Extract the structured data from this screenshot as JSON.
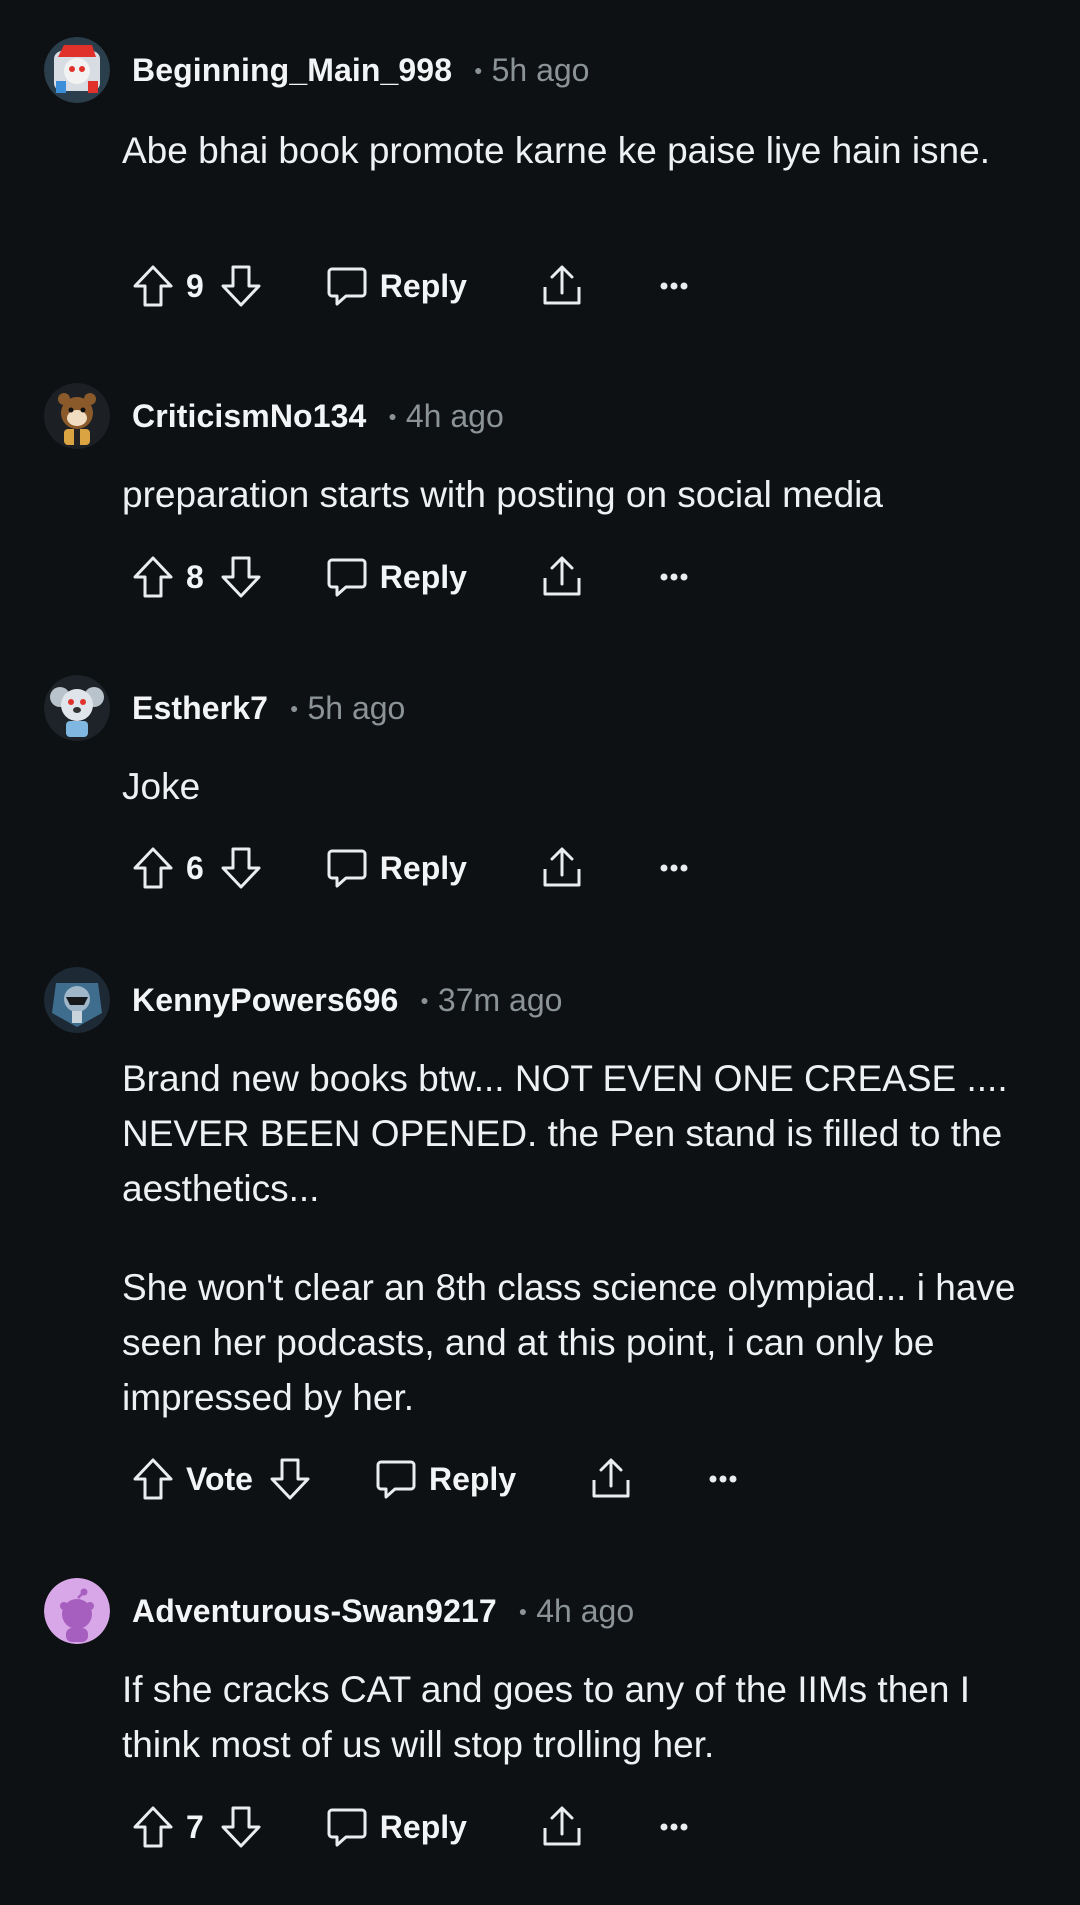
{
  "colors": {
    "background": "#0e1113",
    "text": "#eef1f2",
    "muted": "#8b9396"
  },
  "actions": {
    "reply_label": "Reply"
  },
  "comments": [
    {
      "username": "Beginning_Main_998",
      "time": "5h ago",
      "body": [
        "Abe bhai book promote karne ke paise liye hain isne."
      ],
      "votes": "9",
      "avatar": "snoo-avatar-red-hat"
    },
    {
      "username": "CriticismNo134",
      "time": "4h ago",
      "body": [
        "preparation starts with posting on social media"
      ],
      "votes": "8",
      "avatar": "snoo-avatar-bear"
    },
    {
      "username": "Estherk7",
      "time": "5h ago",
      "body": [
        "Joke"
      ],
      "votes": "6",
      "avatar": "snoo-avatar-koala"
    },
    {
      "username": "KennyPowers696",
      "time": "37m ago",
      "body": [
        "Brand new books btw... NOT EVEN ONE CREASE .... NEVER BEEN OPENED. the Pen stand is filled to the aesthetics...",
        "She won't clear an 8th class science olympiad... i have seen her podcasts, and at this point, i can only be impressed by her."
      ],
      "votes": "Vote",
      "avatar": "snoo-avatar-mech"
    },
    {
      "username": "Adventurous-Swan9217",
      "time": "4h ago",
      "body": [
        "If she cracks CAT and goes to any of the IIMs then I think most of us will stop trolling her."
      ],
      "votes": "7",
      "avatar": "snoo-avatar-default-purple"
    }
  ]
}
